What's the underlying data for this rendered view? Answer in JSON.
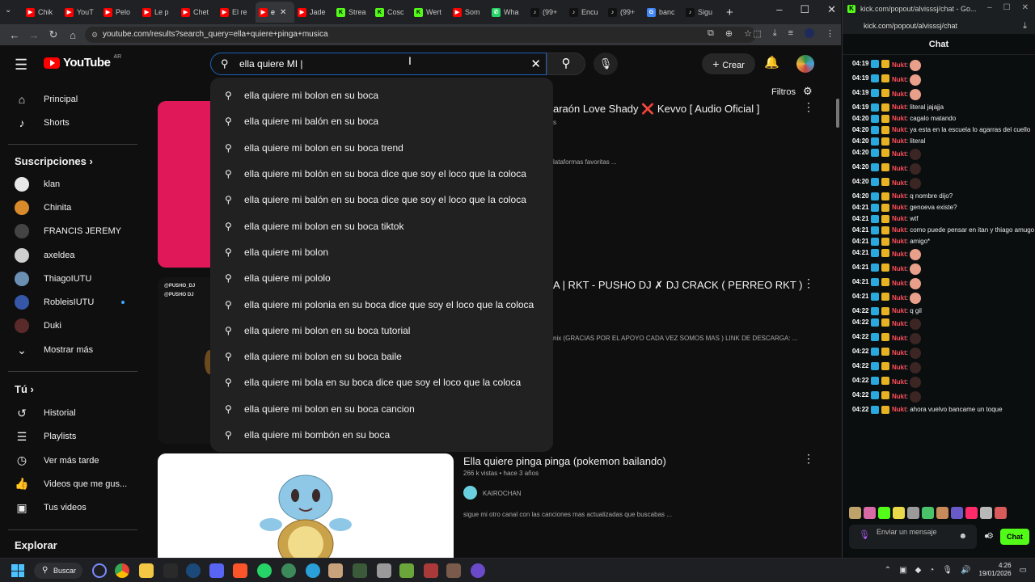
{
  "browser": {
    "tabs": [
      {
        "label": "Chik",
        "color": "#ff0000",
        "glyph": "▶"
      },
      {
        "label": "YouT",
        "color": "#ff0000",
        "glyph": "▶"
      },
      {
        "label": "Pelo",
        "color": "#ff0000",
        "glyph": "▶"
      },
      {
        "label": "Le p",
        "color": "#ff0000",
        "glyph": "▶"
      },
      {
        "label": "Chet",
        "color": "#ff0000",
        "glyph": "▶"
      },
      {
        "label": "El re",
        "color": "#ff0000",
        "glyph": "▶"
      },
      {
        "label": "e",
        "color": "#ff0000",
        "glyph": "▶",
        "active": true
      },
      {
        "label": "Jade",
        "color": "#ff0000",
        "glyph": "▶"
      },
      {
        "label": "Strea",
        "color": "#53fc18",
        "glyph": "K"
      },
      {
        "label": "Cosc",
        "color": "#53fc18",
        "glyph": "K"
      },
      {
        "label": "Wert",
        "color": "#53fc18",
        "glyph": "K"
      },
      {
        "label": "Som",
        "color": "#ff0000",
        "glyph": "▶"
      },
      {
        "label": "Wha",
        "color": "#25d366",
        "glyph": "✆"
      },
      {
        "label": "(99+",
        "color": "#111111",
        "glyph": "♪"
      },
      {
        "label": "Encu",
        "color": "#111111",
        "glyph": "♪"
      },
      {
        "label": "(99+",
        "color": "#111111",
        "glyph": "♪"
      },
      {
        "label": "banc",
        "color": "#4285f4",
        "glyph": "G"
      },
      {
        "label": "Sigu",
        "color": "#111111",
        "glyph": "♪"
      }
    ],
    "url": "youtube.com/results?search_query=ella+quiere+pinga+musica"
  },
  "youtube": {
    "logo_text": "YouTube",
    "country": "AR",
    "search_value": "ella quiere MI |",
    "create_label": "Crear",
    "filters_label": "Filtros",
    "sidebar": {
      "main": [
        {
          "label": "Principal",
          "icon": "⌂"
        },
        {
          "label": "Shorts",
          "icon": "♪"
        }
      ],
      "subs_header": "Suscripciones  ›",
      "subs": [
        {
          "label": "klan",
          "color": "#e8e8e8",
          "live": false
        },
        {
          "label": "Chinita",
          "color": "#d98a2b",
          "live": false
        },
        {
          "label": "FRANCIS JEREMY",
          "color": "#444444",
          "live": false
        },
        {
          "label": "axeldea",
          "color": "#cfcfcf",
          "live": false
        },
        {
          "label": "ThiagoIUTU",
          "color": "#6b8fb3",
          "live": false
        },
        {
          "label": "RobleisIUTU",
          "color": "#3657a8",
          "live": true
        },
        {
          "label": "Duki",
          "color": "#5a2a2a",
          "live": false
        }
      ],
      "show_more": "Mostrar más",
      "you_header": "Tú  ›",
      "you": [
        {
          "label": "Historial",
          "icon": "↺"
        },
        {
          "label": "Playlists",
          "icon": "☰"
        },
        {
          "label": "Ver más tarde",
          "icon": "◷"
        },
        {
          "label": "Videos que me gus...",
          "icon": "👍"
        },
        {
          "label": "Tus videos",
          "icon": "▣"
        }
      ],
      "explore_header": "Explorar"
    },
    "results": [
      {
        "title": "araón Love Shady ❌ Kevvo [ Audio Oficial ]",
        "meta1": "s",
        "desc": "lataformas favoritas ..."
      },
      {
        "title": "A | RKT - PUSHO DJ ✗ DJ CRACK ( PERREO RKT )",
        "meta1": "",
        "desc": "nix (GRACIAS POR EL APOYO CADA VEZ SOMOS MAS ) LINK DE DESCARGA: ...",
        "thumb_text_1": "@PUSHO_DJ",
        "thumb_text_2": "@PUSHO DJ"
      },
      {
        "title": "Ella quiere pinga pinga (pokemon bailando)",
        "meta1": "266 k vistas • hace 3 años",
        "channel": "KAIROCHAN",
        "desc": "sigue mi otro canal con las canciones mas actualizadas que buscabas ..."
      }
    ],
    "suggestions": [
      "ella quiere mi bolon en su boca",
      "ella quiere mi balón en su boca",
      "ella quiere mi bolon en su boca trend",
      "ella quiere mi bolón en su boca dice que soy el loco que la coloca",
      "ella quiere mi balón en su boca dice que soy el loco que la coloca",
      "ella quiere mi bolon en su boca tiktok",
      "ella quiere mi bolon",
      "ella quiere mi pololo",
      "ella quiere mi polonia en su boca dice que soy el loco que la coloca",
      "ella quiere mi bolon en su boca tutorial",
      "ella quiere mi bolon en su boca baile",
      "ella quiere mi bola en su boca dice que soy el loco que la coloca",
      "ella quiere mi bolon en su boca cancion",
      "ella quiere mi bombón en su boca"
    ]
  },
  "kick": {
    "window_title": "kick.com/popout/alvisssj/chat - Go...",
    "url": "kick.com/popout/alvisssj/chat",
    "chat_title": "Chat",
    "messages": [
      {
        "time": "04:19",
        "user": "Nukt",
        "text": "",
        "emote": "light"
      },
      {
        "time": "04:19",
        "user": "Nukt",
        "text": "",
        "emote": "light"
      },
      {
        "time": "04:19",
        "user": "Nukt",
        "text": "",
        "emote": "light"
      },
      {
        "time": "04:19",
        "user": "Nukt",
        "text": "literal jajajja",
        "emote": ""
      },
      {
        "time": "04:20",
        "user": "Nukt",
        "text": "cagalo matando",
        "emote": ""
      },
      {
        "time": "04:20",
        "user": "Nukt",
        "text": "ya esta en la escuela lo agarras del cuello",
        "emote": ""
      },
      {
        "time": "04:20",
        "user": "Nukt",
        "text": "literal",
        "emote": ""
      },
      {
        "time": "04:20",
        "user": "Nukt",
        "text": "",
        "emote": "dark"
      },
      {
        "time": "04:20",
        "user": "Nukt",
        "text": "",
        "emote": "dark"
      },
      {
        "time": "04:20",
        "user": "Nukt",
        "text": "",
        "emote": "dark"
      },
      {
        "time": "04:20",
        "user": "Nukt",
        "text": "q nombre dijo?",
        "emote": ""
      },
      {
        "time": "04:21",
        "user": "Nukt",
        "text": "genoeva existe?",
        "emote": ""
      },
      {
        "time": "04:21",
        "user": "Nukt",
        "text": "wtf",
        "emote": ""
      },
      {
        "time": "04:21",
        "user": "Nukt",
        "text": "como puede pensar en itan y thiago amugo",
        "emote": ""
      },
      {
        "time": "04:21",
        "user": "Nukt",
        "text": "amigo*",
        "emote": ""
      },
      {
        "time": "04:21",
        "user": "Nukt",
        "text": "",
        "emote": "light"
      },
      {
        "time": "04:21",
        "user": "Nukt",
        "text": "",
        "emote": "light"
      },
      {
        "time": "04:21",
        "user": "Nukt",
        "text": "",
        "emote": "light"
      },
      {
        "time": "04:21",
        "user": "Nukt",
        "text": "",
        "emote": "light"
      },
      {
        "time": "04:22",
        "user": "Nukt",
        "text": "q gil",
        "emote": ""
      },
      {
        "time": "04:22",
        "user": "Nukt",
        "text": "",
        "emote": "dark"
      },
      {
        "time": "04:22",
        "user": "Nukt",
        "text": "",
        "emote": "dark"
      },
      {
        "time": "04:22",
        "user": "Nukt",
        "text": "",
        "emote": "dark"
      },
      {
        "time": "04:22",
        "user": "Nukt",
        "text": "",
        "emote": "dark"
      },
      {
        "time": "04:22",
        "user": "Nukt",
        "text": "",
        "emote": "dark"
      },
      {
        "time": "04:22",
        "user": "Nukt",
        "text": "",
        "emote": "dark"
      },
      {
        "time": "04:22",
        "user": "Nukt",
        "text": "ahora vuelvo bancame un toque",
        "emote": ""
      }
    ],
    "input_placeholder": "Enviar un mensaje",
    "chat_button": "Chat"
  },
  "taskbar": {
    "search_label": "Buscar",
    "time": "4:26",
    "date": "19/01/2026"
  }
}
